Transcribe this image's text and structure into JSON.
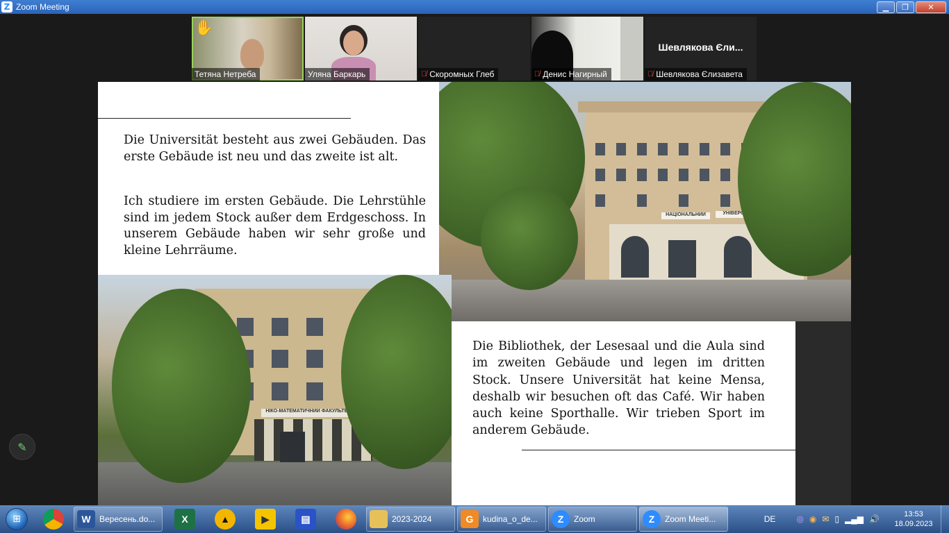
{
  "window": {
    "title": "Zoom Meeting",
    "logo": "Z"
  },
  "participants": [
    {
      "name": "Тетяна Нетреба",
      "muted": false,
      "hand": true,
      "active": true
    },
    {
      "name": "Уляна Баркарь",
      "muted": false,
      "hand": false,
      "active": false
    },
    {
      "name": "Скоромных Глеб",
      "muted": true,
      "hand": false,
      "active": false
    },
    {
      "name": "Денис Нагирный",
      "muted": true,
      "hand": false,
      "active": false
    },
    {
      "name": "Шевлякова Єлизавета",
      "muted": true,
      "hand": false,
      "active": false,
      "display_name": "Шевлякова Єли..."
    }
  ],
  "slide": {
    "para1": "Die Universität besteht aus zwei Gebäuden. Das erste Gebäude ist neu und das zweite ist alt.",
    "para2": "Ich studiere im ersten Gebäude. Die Lehrstühle sind im jedem Stock außer dem Erdgeschoss. In unserem Gebäude haben wir sehr große und kleine Lehrräume.",
    "para3": "Die Bibliothek, der Lesesaal und die Aula sind im zweiten Gebäude und legen im dritten Stock. Unsere Universität hat keine Mensa, deshalb wir besuchen oft das Café. Wir haben auch keine Sporthalle. Wir trieben Sport im anderem Gebäude.",
    "sign1a": "НАЦІОНАЛЬНИЙ",
    "sign1b": "УНІВЕРСИТЕТ",
    "sign2": "НІКО-МАТЕМАТИЧНИЙ ФАКУЛЬТЕТ"
  },
  "taskbar": {
    "tasks": [
      {
        "label": "Вересень.do...",
        "icon": "W",
        "color": "#2b579a"
      },
      {
        "label": "2023-2024",
        "icon": "",
        "color": "#e6c15a"
      },
      {
        "label": "kudina_o_de...",
        "icon": "G",
        "color": "#f08a24"
      },
      {
        "label": "Zoom",
        "icon": "Z",
        "color": "#2d8cff"
      },
      {
        "label": "Zoom Meeti...",
        "icon": "Z",
        "color": "#2d8cff"
      }
    ],
    "pinned": [
      {
        "name": "chrome-icon",
        "icon": "◉",
        "color": "#c94a3a"
      },
      {
        "name": "excel-icon",
        "icon": "X",
        "color": "#1e7145"
      },
      {
        "name": "avast-icon",
        "icon": "▲",
        "color": "#f2b600"
      },
      {
        "name": "player-icon",
        "icon": "▶",
        "color": "#f5c400"
      },
      {
        "name": "floppy-icon",
        "icon": "▤",
        "color": "#2a53c8"
      },
      {
        "name": "firefox-icon",
        "icon": "●",
        "color": "#e8632b"
      }
    ],
    "lang": "DE",
    "time": "13:53",
    "date": "18.09.2023"
  }
}
